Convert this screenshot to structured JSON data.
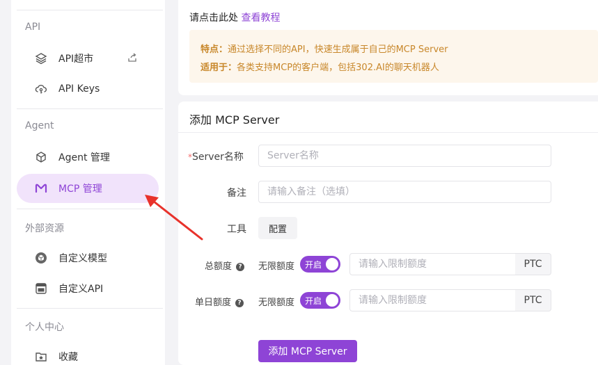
{
  "sidebar": {
    "sections": {
      "api": "API",
      "agent": "Agent",
      "external": "外部资源",
      "personal": "个人中心"
    },
    "items": {
      "api_market": "API超市",
      "api_keys": "API Keys",
      "agent_manage": "Agent 管理",
      "mcp_manage": "MCP 管理",
      "custom_model": "自定义模型",
      "custom_api": "自定义API",
      "favorites": "收藏"
    }
  },
  "intro": {
    "prompt": "请点击此处",
    "tutorial_link": "查看教程",
    "feature_label": "特点：",
    "feature_text": "通过选择不同的API，快速生成属于自己的MCP Server",
    "applies_label": "适用于：",
    "applies_text": "各类支持MCP的客户端，包括302.AI的聊天机器人"
  },
  "form": {
    "title": "添加 MCP Server",
    "server_name_label": "Server名称",
    "server_name_placeholder": "Server名称",
    "remark_label": "备注",
    "remark_placeholder": "请输入备注（选填）",
    "tools_label": "工具",
    "tools_button": "配置",
    "total_quota_label": "总额度",
    "daily_quota_label": "单日额度",
    "unlimited_label": "无限额度",
    "toggle_on": "开启",
    "limit_placeholder": "请输入限制额度",
    "unit": "PTC",
    "submit": "添加 MCP Server"
  },
  "colors": {
    "accent": "#8e44d6",
    "active_bg": "#f1e3fb",
    "notice_bg": "#fdf6ec",
    "notice_text": "#c8872a",
    "arrow": "#e8322b"
  }
}
